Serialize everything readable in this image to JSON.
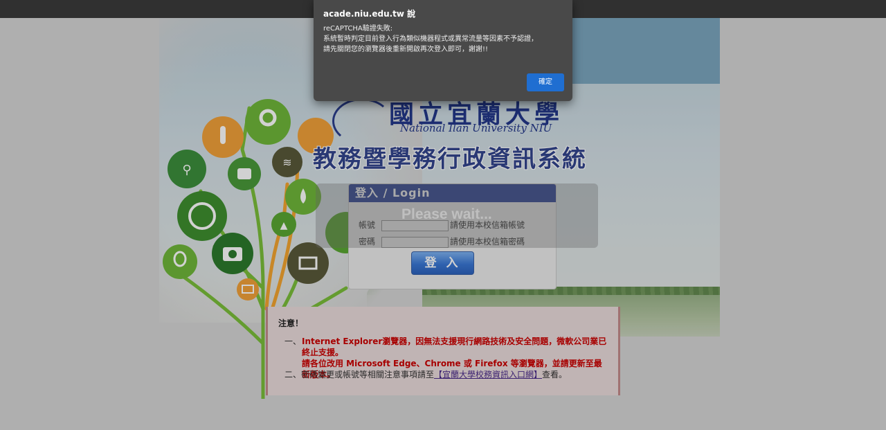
{
  "dialog": {
    "title": "acade.niu.edu.tw 說",
    "message": "reCAPTCHA驗證失敗:\n系統暫時判定目前登入行為類似機器程式或異常流量等因素不予認證，\n請先關閉您的瀏覽器後重新開啟再次登入即可，謝謝!!",
    "ok_label": "確定"
  },
  "branding": {
    "university_cn": "國立宜蘭大學",
    "university_en": "National Ilan University   NIU",
    "system_title": "教務暨學務行政資訊系統"
  },
  "login": {
    "heading": "登入 / Login",
    "account_label": "帳號",
    "account_hint": "請使用本校信箱帳號",
    "password_label": "密碼",
    "password_hint": "請使用本校信箱密碼",
    "submit_label": "登 入",
    "wait_text": "Please wait..."
  },
  "notice": {
    "title": "注意！",
    "item1_num": "一、",
    "item1_text": "Internet Explorer瀏覽器，因無法支援現行網路技術及安全問題，微軟公司業已終止支援。",
    "item1_text2": "請各位改用 Microsoft Edge、Chrome 或 Firefox 等瀏覽器，並請更新至最新版本。",
    "item2_prefix": "二、密碼變更或帳號等相關注意事項請至",
    "item2_link": "【宜蘭大學校務資訊入口網】",
    "item2_suffix": "查看。"
  },
  "icons": [
    "bicycle-icon",
    "thermometer-icon",
    "map-pin-icon",
    "palette-icon",
    "globe-icon",
    "camera-icon",
    "robot-icon",
    "wifi-icon",
    "water-drop-icon",
    "upload-cloud-icon",
    "balloon-icon",
    "book-icon",
    "leaf-icon",
    "recycle-icon"
  ],
  "colors": {
    "header_blue": "#2e469a",
    "notice_red": "#cc0000",
    "ok_blue": "#1f6ed1"
  }
}
